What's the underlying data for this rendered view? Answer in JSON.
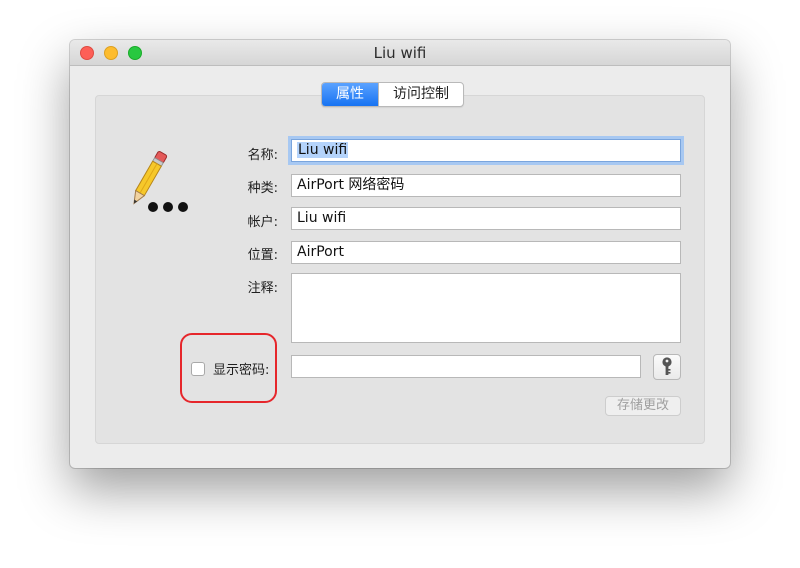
{
  "window": {
    "title": "Liu wifi"
  },
  "tabs": [
    {
      "label": "属性",
      "active": true
    },
    {
      "label": "访问控制",
      "active": false
    }
  ],
  "fields": {
    "name": {
      "label": "名称:",
      "value": "Liu wifi"
    },
    "kind": {
      "label": "种类:",
      "value": "AirPort 网络密码"
    },
    "account": {
      "label": "帐户:",
      "value": "Liu wifi"
    },
    "where": {
      "label": "位置:",
      "value": "AirPort"
    },
    "comments": {
      "label": "注释:",
      "value": ""
    }
  },
  "show_password": {
    "label": "显示密码:",
    "checked": false,
    "value": ""
  },
  "buttons": {
    "save": "存储更改"
  },
  "icons": {
    "app": "pencil-dots-icon",
    "key": "key-icon"
  },
  "colors": {
    "accent": "#1773f2",
    "highlight_ring": "#e6262b"
  }
}
